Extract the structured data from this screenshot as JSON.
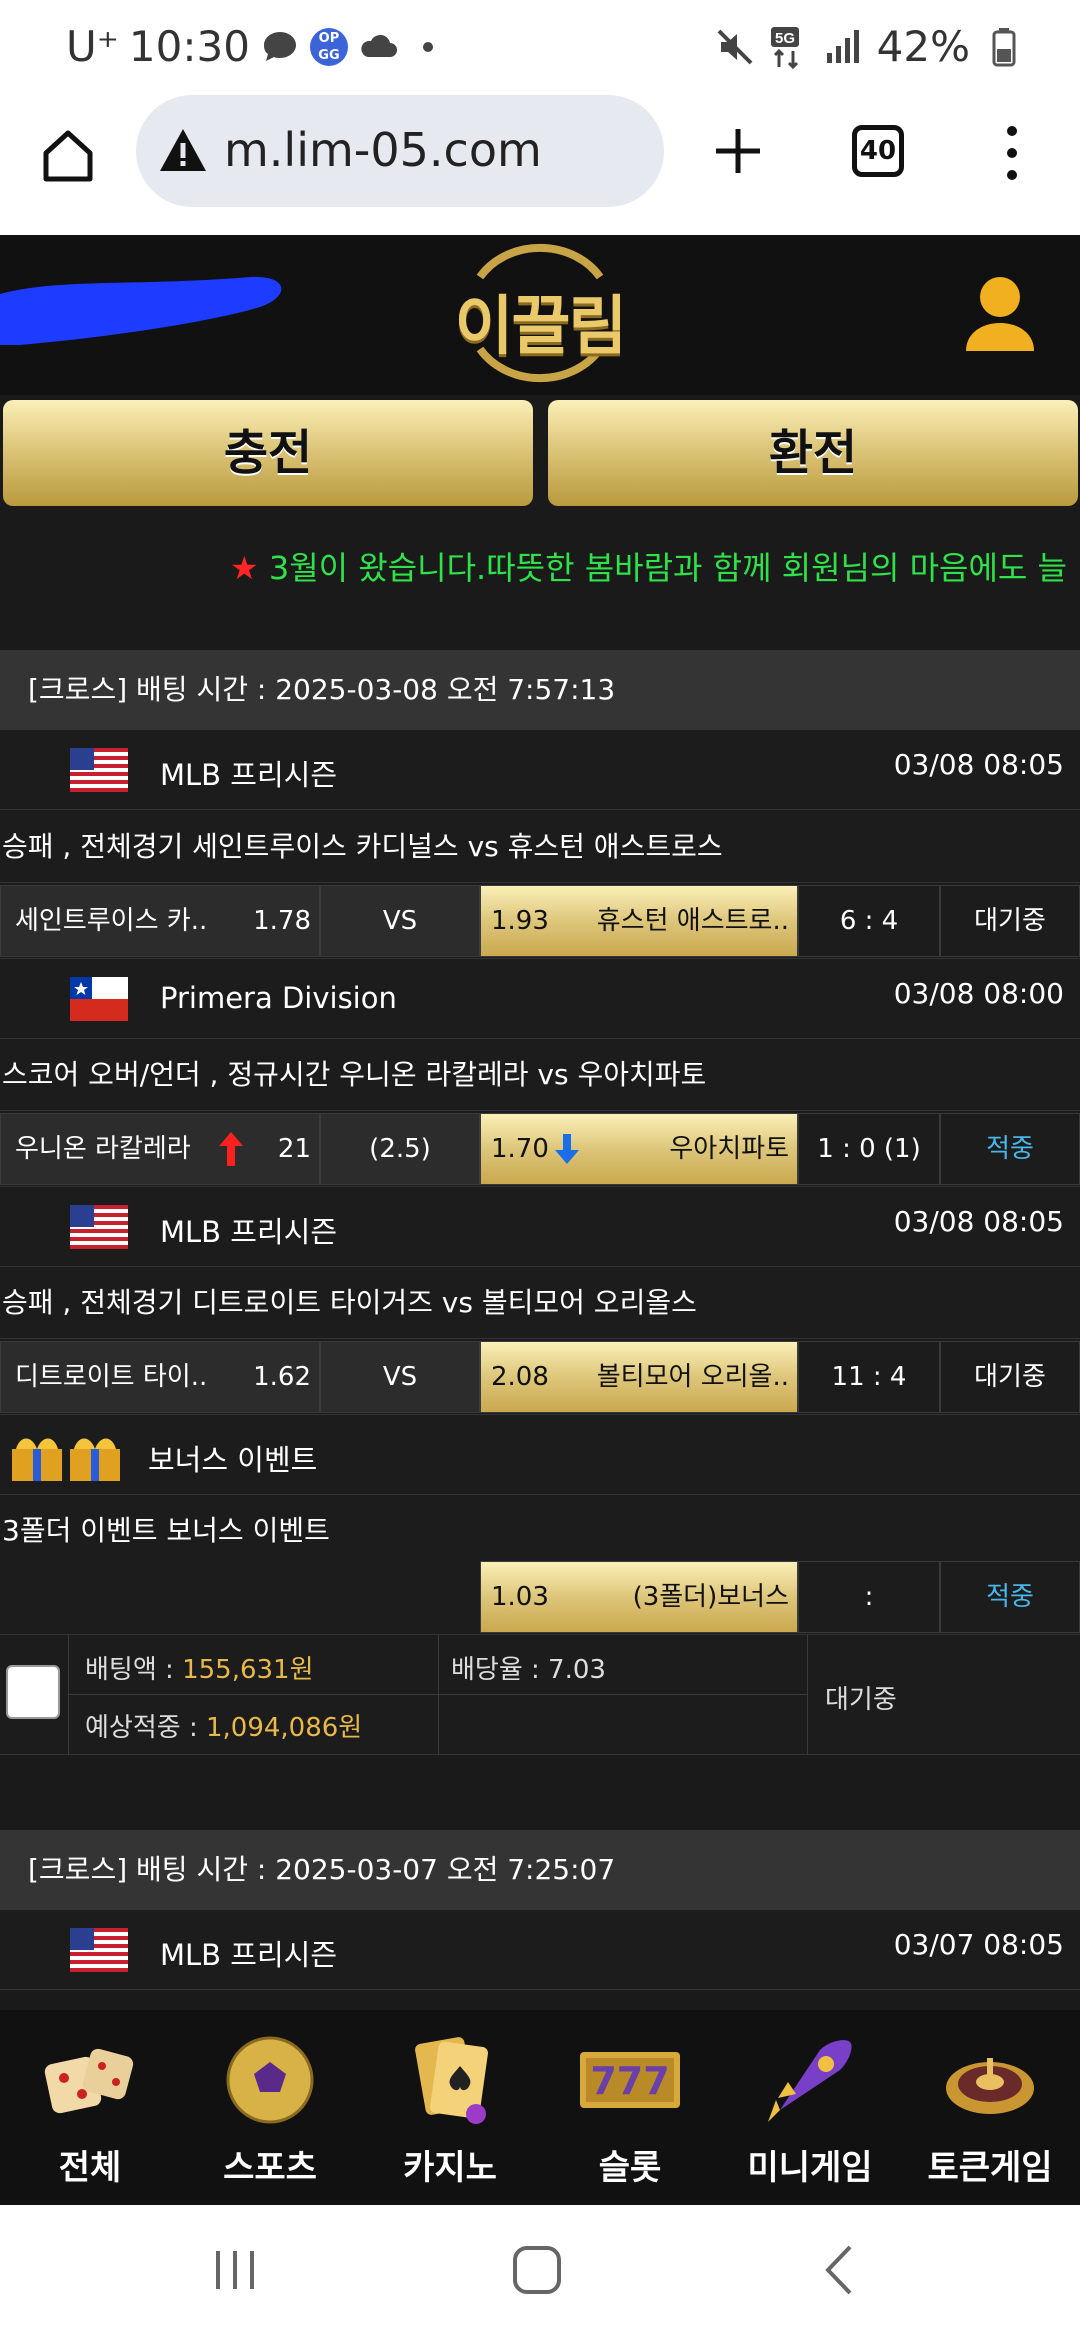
{
  "status_bar": {
    "carrier": "U⁺",
    "time": "10:30",
    "battery": "42%",
    "network": "5G",
    "left_icons": [
      "chat-bubble-icon",
      "opgg-app-icon",
      "cloud-icon",
      "dot-icon"
    ],
    "right_icons": [
      "mute-icon",
      "5g-icon",
      "signal-icon",
      "battery-icon"
    ],
    "opgg_top": "OP",
    "opgg_bottom": "GG"
  },
  "browser": {
    "url": "m.lim-05.com",
    "tab_count": "40"
  },
  "site": {
    "logo_text": "이끌림",
    "buttons": {
      "charge": "충전",
      "withdraw": "환전"
    },
    "marquee_star": "★",
    "marquee_text": "3월이 왔습니다.따뜻한 봄바람과 함께 회원님의 마음에도 늘"
  },
  "bet_slips": [
    {
      "header": "[크로스] 배팅 시간 : 2025-03-08 오전 7:57:13",
      "games": [
        {
          "league": "MLB 프리시즌",
          "flag": "us",
          "time": "03/08 08:05",
          "desc": "승패 , 전체경기 세인트루이스 카디널스  vs  휴스턴 애스트로스",
          "home": "세인트루이스 카..",
          "home_odds": "1.78",
          "mid": "VS",
          "away_odds": "1.93",
          "away": "휴스턴 애스트로..",
          "score": "6 : 4",
          "status": "대기중"
        },
        {
          "league": "Primera Division",
          "flag": "cl",
          "time": "03/08 08:00",
          "desc": "스코어 오버/언더 , 정규시간 우니온 라칼레라  vs  우아치파토",
          "home": "우니온 라칼레라",
          "home_odds": "21",
          "mid": "(2.5)",
          "away_odds": "1.70",
          "away": "우아치파토",
          "score": "1 : 0 (1)",
          "status": "적중"
        },
        {
          "league": "MLB 프리시즌",
          "flag": "us",
          "time": "03/08 08:05",
          "desc": "승패 , 전체경기 디트로이트 타이거즈  vs  볼티모어 오리올스",
          "home": "디트로이트 타이..",
          "home_odds": "1.62",
          "mid": "VS",
          "away_odds": "2.08",
          "away": "볼티모어 오리올..",
          "score": "11 : 4",
          "status": "대기중"
        }
      ],
      "bonus": {
        "title": "보너스 이벤트",
        "desc": "3폴더 이벤트 보너스 이벤트",
        "odds": "1.03",
        "label": "(3폴더)보너스",
        "score": ":",
        "status": "적중"
      },
      "summary": {
        "bet_amount_label": "배팅액 : ",
        "bet_amount": "155,631원",
        "odds_label": "배당율 : 7.03",
        "expected_label": "예상적중 : ",
        "expected": "1,094,086원",
        "status": "대기중"
      }
    },
    {
      "header": "[크로스] 배팅 시간 : 2025-03-07 오전 7:25:07",
      "games": [
        {
          "league": "MLB 프리시즌",
          "flag": "us",
          "time": "03/07 08:05"
        }
      ]
    }
  ],
  "bottom_nav": [
    {
      "label": "전체",
      "icon": "dice-icon"
    },
    {
      "label": "스포츠",
      "icon": "soccer-ball-icon"
    },
    {
      "label": "카지노",
      "icon": "cards-icon"
    },
    {
      "label": "슬롯",
      "icon": "slot-777-icon"
    },
    {
      "label": "미니게임",
      "icon": "rocket-icon"
    },
    {
      "label": "토큰게임",
      "icon": "roulette-icon"
    }
  ],
  "colors": {
    "gold": "#ddc67a",
    "marquee_green": "#2fe24a",
    "star_red": "#ff2626",
    "win_cyan": "#46b7e8",
    "amount_gold": "#e8b84a"
  }
}
